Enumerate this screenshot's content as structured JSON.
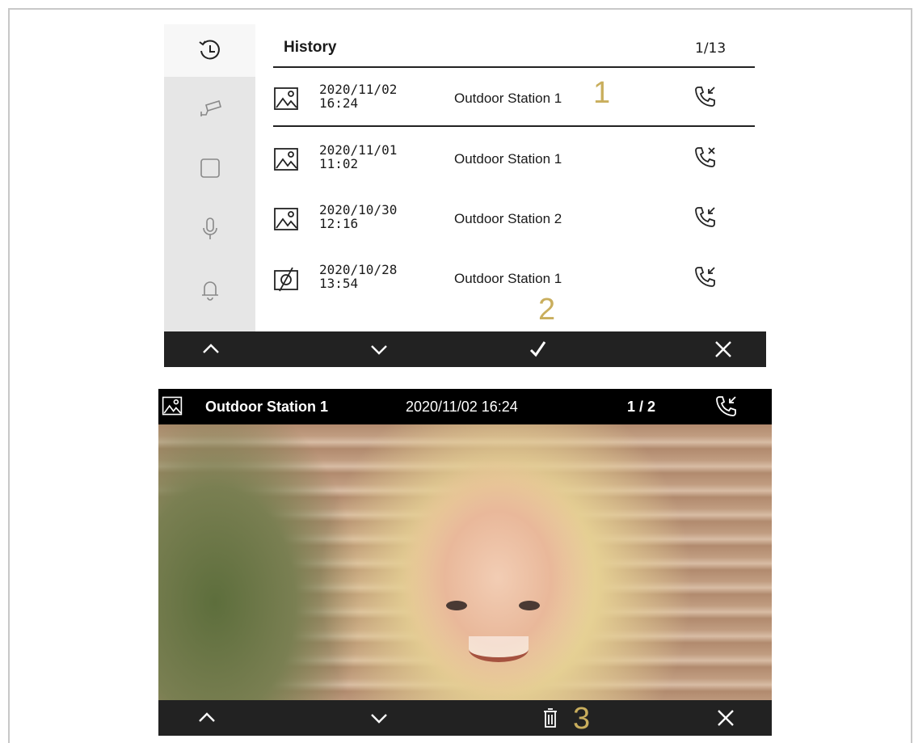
{
  "colors": {
    "bar": "#222222",
    "sidebar": "#e6e6e6",
    "marker": "#c9ae5d",
    "header": "#000000"
  },
  "sidebar": {
    "items": [
      {
        "icon": "history-icon",
        "active": true
      },
      {
        "icon": "camera-icon",
        "active": false
      },
      {
        "icon": "square-icon",
        "active": false
      },
      {
        "icon": "microphone-icon",
        "active": false
      },
      {
        "icon": "bell-icon",
        "active": false
      }
    ]
  },
  "history": {
    "title": "History",
    "page": "1/13",
    "rows": [
      {
        "thumb": "image-icon",
        "date": "2020/11/02",
        "time": "16:24",
        "station": "Outdoor Station 1",
        "call": "call-incoming-icon"
      },
      {
        "thumb": "image-icon",
        "date": "2020/11/01",
        "time": "11:02",
        "station": "Outdoor Station 1",
        "call": "call-missed-icon"
      },
      {
        "thumb": "image-icon",
        "date": "2020/10/30",
        "time": "12:16",
        "station": "Outdoor Station 2",
        "call": "call-incoming-icon"
      },
      {
        "thumb": "no-image-icon",
        "date": "2020/10/28",
        "time": "13:54",
        "station": "Outdoor Station 1",
        "call": "call-incoming-icon"
      }
    ]
  },
  "top_bar": {
    "buttons": [
      "chevron-up-icon",
      "chevron-down-icon",
      "check-icon",
      "close-icon"
    ]
  },
  "photo": {
    "station": "Outdoor Station 1",
    "datetime": "2020/11/02 16:24",
    "page": "1 / 2",
    "thumb": "image-icon",
    "call": "call-incoming-icon"
  },
  "photo_bar": {
    "buttons": [
      "chevron-up-icon",
      "chevron-down-icon",
      "trash-icon",
      "close-icon"
    ]
  },
  "markers": {
    "m1": "1",
    "m2": "2",
    "m3": "3"
  }
}
